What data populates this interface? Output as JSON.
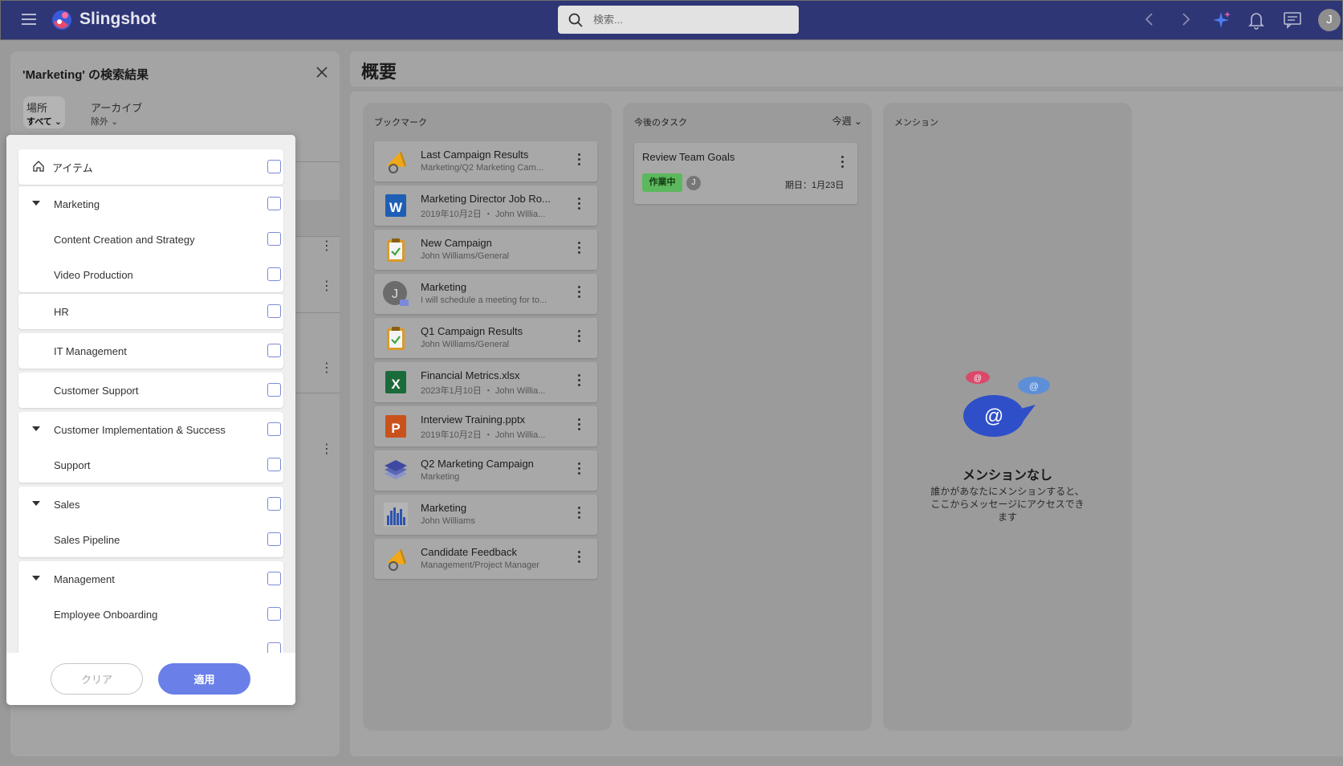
{
  "app": {
    "name": "Slingshot",
    "user_initial": "J"
  },
  "search": {
    "placeholder": "検索..."
  },
  "search_panel": {
    "title": "'Marketing' の検索結果",
    "filters": {
      "location": {
        "label": "場所",
        "value": "すべて"
      },
      "archive": {
        "label": "アーカイブ",
        "value": "除外"
      }
    }
  },
  "location_dropdown": {
    "groups": [
      {
        "items": [
          {
            "label": "アイテム",
            "icon": "home-icon"
          }
        ]
      },
      {
        "items": [
          {
            "label": "Marketing",
            "expanded": true
          },
          {
            "label": "Content Creation and Strategy"
          },
          {
            "label": "Video Production"
          }
        ]
      },
      {
        "items": [
          {
            "label": "HR"
          }
        ]
      },
      {
        "items": [
          {
            "label": "IT Management"
          }
        ]
      },
      {
        "items": [
          {
            "label": "Customer Support"
          }
        ]
      },
      {
        "items": [
          {
            "label": "Customer Implementation & Success",
            "expanded": true
          },
          {
            "label": "Support"
          }
        ]
      },
      {
        "items": [
          {
            "label": "Sales",
            "expanded": true
          },
          {
            "label": "Sales Pipeline"
          }
        ]
      },
      {
        "items": [
          {
            "label": "Management",
            "expanded": true
          },
          {
            "label": "Employee Onboarding"
          },
          {
            "label": ""
          }
        ]
      }
    ],
    "clear_label": "クリア",
    "apply_label": "適用"
  },
  "overview": {
    "title": "概要",
    "bookmarks": {
      "title": "ブックマーク",
      "items": [
        {
          "title": "Last Campaign Results",
          "subtitle": "Marketing/Q2 Marketing Cam...",
          "icon": "megaphone-icon"
        },
        {
          "title": "Marketing Director Job Ro...",
          "subtitle": "2019年10月2日 ・ John Willia...",
          "icon": "word-icon"
        },
        {
          "title": "New Campaign",
          "subtitle": "John Williams/General",
          "icon": "clipboard-icon"
        },
        {
          "title": "Marketing",
          "subtitle": "I will schedule a meeting for to...",
          "icon": "avatar-message-icon"
        },
        {
          "title": "Q1 Campaign Results",
          "subtitle": "John Williams/General",
          "icon": "clipboard-icon"
        },
        {
          "title": "Financial Metrics.xlsx",
          "subtitle": "2023年1月10日 ・ John Willia...",
          "icon": "excel-icon"
        },
        {
          "title": "Interview Training.pptx",
          "subtitle": "2019年10月2日 ・ John Willia...",
          "icon": "powerpoint-icon"
        },
        {
          "title": "Q2 Marketing Campaign",
          "subtitle": "Marketing",
          "icon": "layers-icon"
        },
        {
          "title": "Marketing",
          "subtitle": "John Williams",
          "icon": "bar-chart-icon"
        },
        {
          "title": "Candidate Feedback",
          "subtitle": "Management/Project Manager",
          "icon": "megaphone-icon"
        }
      ]
    },
    "tasks": {
      "title": "今後のタスク",
      "period": "今週",
      "items": [
        {
          "title": "Review Team Goals",
          "status": "作業中",
          "assignee": "J",
          "due": "期日：1月23日"
        }
      ]
    },
    "mentions": {
      "title": "メンション",
      "empty_title": "メンションなし",
      "empty_desc": "誰かがあなたにメンションすると、ここからメッセージにアクセスできます"
    }
  },
  "colors": {
    "topbar": "#2e3676",
    "accent": "#6a7fe8",
    "status_in_progress": "#5cb85c"
  }
}
